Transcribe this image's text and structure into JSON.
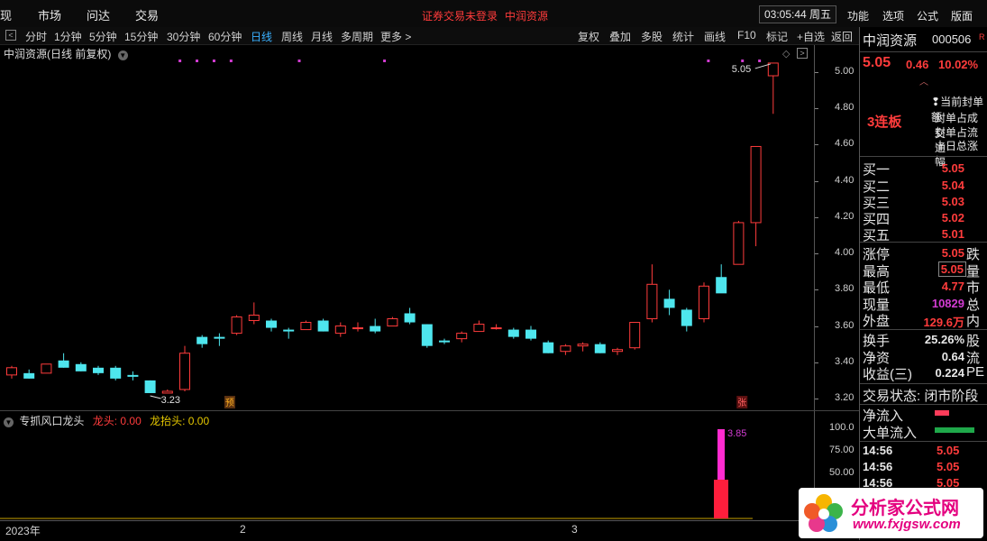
{
  "topbar": {
    "items": [
      "现",
      "市场",
      "问达",
      "交易"
    ],
    "notice_login": "证券交易未登录",
    "notice_stock": "中润资源",
    "clock": "03:05:44 周五",
    "right_items": [
      "功能",
      "选项",
      "公式",
      "版面"
    ]
  },
  "toolbar": {
    "periods": [
      "分时",
      "1分钟",
      "5分钟",
      "15分钟",
      "30分钟",
      "60分钟",
      "日线",
      "周线",
      "月线",
      "多周期",
      "更多 >"
    ],
    "active": "日线",
    "right_items": [
      "复权",
      "叠加",
      "多股",
      "统计",
      "画线",
      "F10",
      "标记",
      "+自选",
      "返回"
    ]
  },
  "chart": {
    "title": "中润资源(日线 前复权)",
    "price_ticks": [
      "5.00",
      "4.80",
      "4.60",
      "4.40",
      "4.20",
      "4.00",
      "3.80",
      "3.60",
      "3.40",
      "3.20"
    ],
    "high_label": "5.05",
    "low_label": "3.23",
    "badge_pre": "预",
    "badge_zhang": "张",
    "up_color": "#ff3c3c",
    "down_color": "#4ee6ee"
  },
  "chart_data": {
    "type": "candlestick",
    "ylim": [
      3.15,
      5.1
    ],
    "candles": [
      {
        "o": 3.33,
        "h": 3.38,
        "l": 3.31,
        "c": 3.37
      },
      {
        "o": 3.34,
        "h": 3.36,
        "l": 3.31,
        "c": 3.31
      },
      {
        "o": 3.34,
        "h": 3.39,
        "l": 3.34,
        "c": 3.39
      },
      {
        "o": 3.41,
        "h": 3.45,
        "l": 3.37,
        "c": 3.37
      },
      {
        "o": 3.39,
        "h": 3.4,
        "l": 3.35,
        "c": 3.35
      },
      {
        "o": 3.37,
        "h": 3.38,
        "l": 3.33,
        "c": 3.34
      },
      {
        "o": 3.37,
        "h": 3.38,
        "l": 3.3,
        "c": 3.31
      },
      {
        "o": 3.33,
        "h": 3.35,
        "l": 3.3,
        "c": 3.32
      },
      {
        "o": 3.3,
        "h": 3.3,
        "l": 3.23,
        "c": 3.23
      },
      {
        "o": 3.23,
        "h": 3.25,
        "l": 3.23,
        "c": 3.24
      },
      {
        "o": 3.25,
        "h": 3.49,
        "l": 3.24,
        "c": 3.45
      },
      {
        "o": 3.54,
        "h": 3.55,
        "l": 3.48,
        "c": 3.5
      },
      {
        "o": 3.54,
        "h": 3.56,
        "l": 3.49,
        "c": 3.53
      },
      {
        "o": 3.56,
        "h": 3.66,
        "l": 3.55,
        "c": 3.65
      },
      {
        "o": 3.63,
        "h": 3.73,
        "l": 3.61,
        "c": 3.66
      },
      {
        "o": 3.63,
        "h": 3.64,
        "l": 3.57,
        "c": 3.59
      },
      {
        "o": 3.58,
        "h": 3.59,
        "l": 3.53,
        "c": 3.57
      },
      {
        "o": 3.58,
        "h": 3.63,
        "l": 3.58,
        "c": 3.62
      },
      {
        "o": 3.63,
        "h": 3.64,
        "l": 3.57,
        "c": 3.57
      },
      {
        "o": 3.56,
        "h": 3.62,
        "l": 3.54,
        "c": 3.6
      },
      {
        "o": 3.59,
        "h": 3.62,
        "l": 3.57,
        "c": 3.59
      },
      {
        "o": 3.6,
        "h": 3.64,
        "l": 3.56,
        "c": 3.57
      },
      {
        "o": 3.6,
        "h": 3.65,
        "l": 3.6,
        "c": 3.64
      },
      {
        "o": 3.67,
        "h": 3.7,
        "l": 3.61,
        "c": 3.62
      },
      {
        "o": 3.61,
        "h": 3.61,
        "l": 3.48,
        "c": 3.49
      },
      {
        "o": 3.52,
        "h": 3.53,
        "l": 3.5,
        "c": 3.51
      },
      {
        "o": 3.53,
        "h": 3.57,
        "l": 3.51,
        "c": 3.56
      },
      {
        "o": 3.57,
        "h": 3.63,
        "l": 3.57,
        "c": 3.61
      },
      {
        "o": 3.59,
        "h": 3.61,
        "l": 3.58,
        "c": 3.59
      },
      {
        "o": 3.58,
        "h": 3.59,
        "l": 3.53,
        "c": 3.54
      },
      {
        "o": 3.58,
        "h": 3.6,
        "l": 3.52,
        "c": 3.53
      },
      {
        "o": 3.51,
        "h": 3.52,
        "l": 3.45,
        "c": 3.45
      },
      {
        "o": 3.46,
        "h": 3.5,
        "l": 3.44,
        "c": 3.49
      },
      {
        "o": 3.49,
        "h": 3.51,
        "l": 3.46,
        "c": 3.5
      },
      {
        "o": 3.5,
        "h": 3.51,
        "l": 3.45,
        "c": 3.45
      },
      {
        "o": 3.46,
        "h": 3.48,
        "l": 3.44,
        "c": 3.47
      },
      {
        "o": 3.48,
        "h": 3.62,
        "l": 3.47,
        "c": 3.62
      },
      {
        "o": 3.64,
        "h": 3.94,
        "l": 3.62,
        "c": 3.83
      },
      {
        "o": 3.75,
        "h": 3.8,
        "l": 3.66,
        "c": 3.7
      },
      {
        "o": 3.69,
        "h": 3.7,
        "l": 3.57,
        "c": 3.6
      },
      {
        "o": 3.64,
        "h": 3.84,
        "l": 3.62,
        "c": 3.82
      },
      {
        "o": 3.87,
        "h": 3.94,
        "l": 3.84,
        "c": 3.78
      },
      {
        "o": 3.94,
        "h": 4.18,
        "l": 3.94,
        "c": 4.17
      },
      {
        "o": 4.17,
        "h": 4.59,
        "l": 4.04,
        "c": 4.59
      },
      {
        "o": 4.98,
        "h": 5.05,
        "l": 4.77,
        "c": 5.05
      }
    ],
    "indicator": {
      "title": "专抓风口龙头",
      "series": [
        {
          "name": "龙头",
          "value": "0.00"
        },
        {
          "name": "龙抬头",
          "value": "0.00"
        }
      ],
      "ticks": [
        "100.0",
        "75.00",
        "50.00"
      ],
      "peak_label": "3.85"
    },
    "dates": [
      "2023年",
      "2",
      "3"
    ]
  },
  "right_panel": {
    "stock_name": "中润资源",
    "stock_code": "000506",
    "price": "5.05",
    "change": "0.46",
    "change_pct": "10.02%",
    "streak": "3连板",
    "seal_lines": [
      "当前封单额",
      "封单占成交",
      "封单占流通",
      "十日总涨幅"
    ],
    "bids": [
      {
        "label": "买一",
        "price": "5.05"
      },
      {
        "label": "买二",
        "price": "5.04"
      },
      {
        "label": "买三",
        "price": "5.03"
      },
      {
        "label": "买四",
        "price": "5.02"
      },
      {
        "label": "买五",
        "price": "5.01"
      }
    ],
    "stats": [
      {
        "label": "涨停",
        "value": "5.05",
        "suffix": "跌"
      },
      {
        "label": "最高",
        "value": "5.05",
        "suffix": "量"
      },
      {
        "label": "最低",
        "value": "4.77",
        "suffix": "市"
      },
      {
        "label": "现量",
        "value": "10829",
        "suffix": "总"
      },
      {
        "label": "外盘",
        "value": "129.6万",
        "suffix": "内"
      }
    ],
    "stats2": [
      {
        "label": "换手",
        "value": "25.26%",
        "suffix": "股"
      },
      {
        "label": "净资",
        "value": "0.64",
        "suffix": "流"
      },
      {
        "label": "收益(三)",
        "value": "0.224",
        "suffix": "PE"
      }
    ],
    "trade_state": "交易状态: 闭市阶段",
    "net_inflow": "净流入",
    "big_inflow": "大单流入",
    "ticks": [
      {
        "time": "14:56",
        "price": "5.05"
      },
      {
        "time": "14:56",
        "price": "5.05"
      },
      {
        "time": "14:56",
        "price": "5.05"
      }
    ]
  },
  "logo": {
    "name": "分析家公式网",
    "url": "www.fxjgsw.com"
  }
}
